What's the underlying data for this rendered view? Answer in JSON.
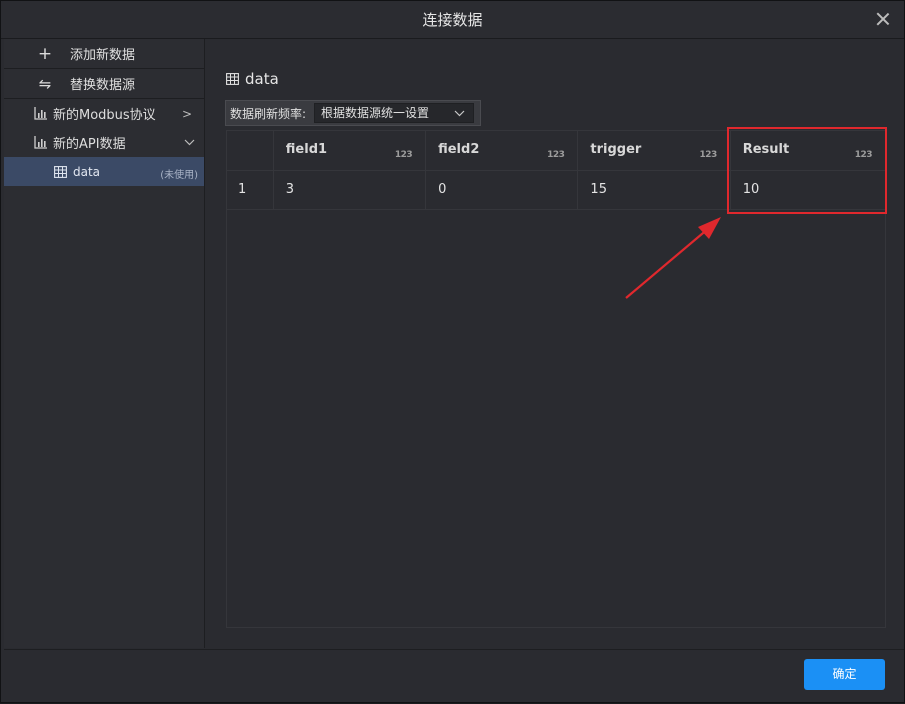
{
  "dialog": {
    "title": "连接数据"
  },
  "sidebar": {
    "actions": [
      {
        "icon": "plus-icon",
        "label": "添加新数据"
      },
      {
        "icon": "swap-icon",
        "label": "替换数据源"
      }
    ],
    "groups": [
      {
        "icon": "bar-chart-icon",
        "label": "新的Modbus协议",
        "expanded": false
      },
      {
        "icon": "bar-chart-icon",
        "label": "新的API数据",
        "expanded": true
      }
    ],
    "selected_item": {
      "icon": "table-icon",
      "label": "data",
      "tag": "(未使用)"
    }
  },
  "main": {
    "dataset_title": "data",
    "refresh_label": "数据刷新频率:",
    "refresh_value": "根据数据源统一设置"
  },
  "table": {
    "columns": [
      {
        "name": "field1",
        "type": "123"
      },
      {
        "name": "field2",
        "type": "123"
      },
      {
        "name": "trigger",
        "type": "123"
      },
      {
        "name": "Result",
        "type": "123"
      }
    ],
    "rows": [
      {
        "index": "1",
        "values": [
          "3",
          "0",
          "15",
          "10"
        ]
      }
    ]
  },
  "annotation": {
    "color": "#e0282d",
    "highlighted_column": "Result"
  },
  "footer": {
    "ok_label": "确定"
  },
  "colors": {
    "accent": "#1b90f5",
    "selected_bg": "#3b4a66"
  }
}
